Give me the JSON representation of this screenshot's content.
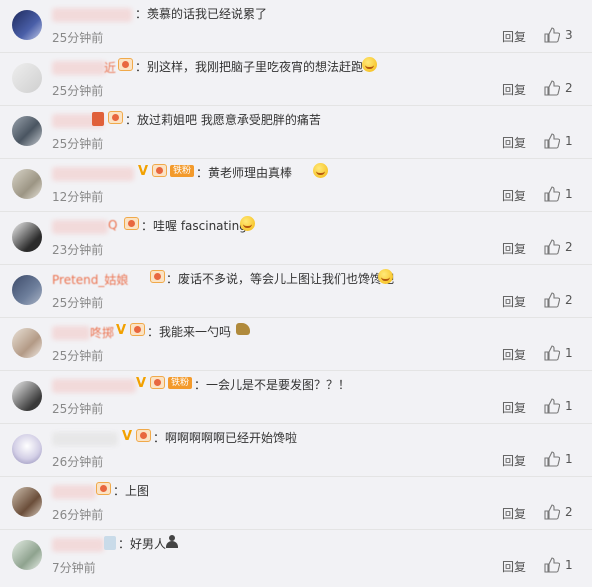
{
  "comments": [
    {
      "name_visible": "",
      "text": "：羡慕的话我已经说累了",
      "time": "25分钟前",
      "reply": "回复",
      "likes": "3"
    },
    {
      "name_visible": "近",
      "text": "：别这样，我刚把脑子里吃夜宵的想法赶跑",
      "time": "25分钟前",
      "reply": "回复",
      "likes": "2"
    },
    {
      "name_visible": "",
      "text": "：放过莉姐吧 我愿意承受肥胖的痛苦",
      "time": "25分钟前",
      "reply": "回复",
      "likes": "1"
    },
    {
      "name_visible": "",
      "text": "：黄老师理由真棒",
      "tag": "铁粉",
      "time": "12分钟前",
      "reply": "回复",
      "likes": "1"
    },
    {
      "name_visible": "Q",
      "text": "：哇喔 fascinating",
      "time": "23分钟前",
      "reply": "回复",
      "likes": "2"
    },
    {
      "name_visible": "Pretend_姑娘",
      "text": "：废话不多说，等会儿上图让我们也馋馋吧",
      "time": "25分钟前",
      "reply": "回复",
      "likes": "2"
    },
    {
      "name_visible": "咚掷",
      "text": "：我能来一勺吗",
      "time": "25分钟前",
      "reply": "回复",
      "likes": "1"
    },
    {
      "name_visible": "",
      "text": "：一会儿是不是要发图？？！",
      "tag": "铁粉",
      "time": "25分钟前",
      "reply": "回复",
      "likes": "1"
    },
    {
      "name_visible": "",
      "text": "：啊啊啊啊啊已经开始馋啦",
      "time": "26分钟前",
      "reply": "回复",
      "likes": "1"
    },
    {
      "name_visible": "",
      "text": "：上图",
      "time": "26分钟前",
      "reply": "回复",
      "likes": "2"
    },
    {
      "name_visible": "",
      "text": "：好男人",
      "time": "7分钟前",
      "reply": "回复",
      "likes": "1"
    }
  ]
}
